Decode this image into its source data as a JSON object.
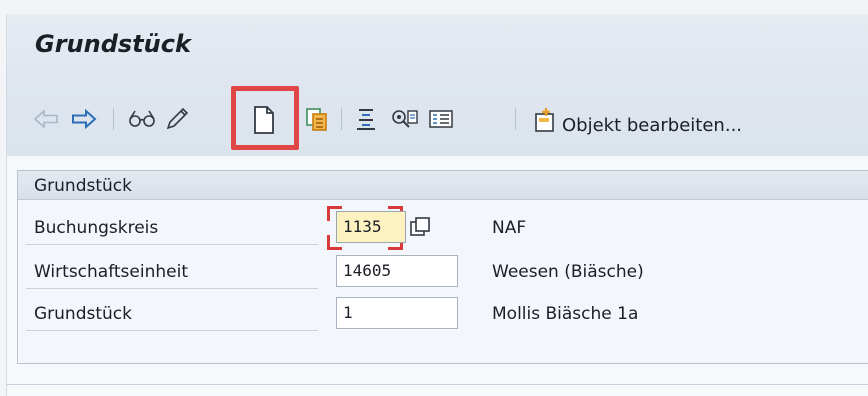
{
  "window": {
    "title": "Grundstück"
  },
  "toolbar": {
    "icons": [
      "back-arrow-icon",
      "forward-arrow-icon",
      "display-glasses-icon",
      "change-pencil-icon",
      "create-document-icon",
      "copy-document-icon",
      "align-icon",
      "settings-icon",
      "list-view-icon",
      "edit-object-icon"
    ],
    "edit_object_label": "Objekt bearbeiten..."
  },
  "group": {
    "title": "Grundstück",
    "rows": [
      {
        "label": "Buchungskreis",
        "value": "1135",
        "description": "NAF"
      },
      {
        "label": "Wirtschaftseinheit",
        "value": "14605",
        "description": "Weesen (Biäsche)"
      },
      {
        "label": "Grundstück",
        "value": "1",
        "description": "Mollis Biäsche 1a"
      }
    ]
  },
  "colors": {
    "highlight": "#e04646",
    "required_corners": "#d63a3a",
    "focus_field": "#fdf1c0"
  }
}
